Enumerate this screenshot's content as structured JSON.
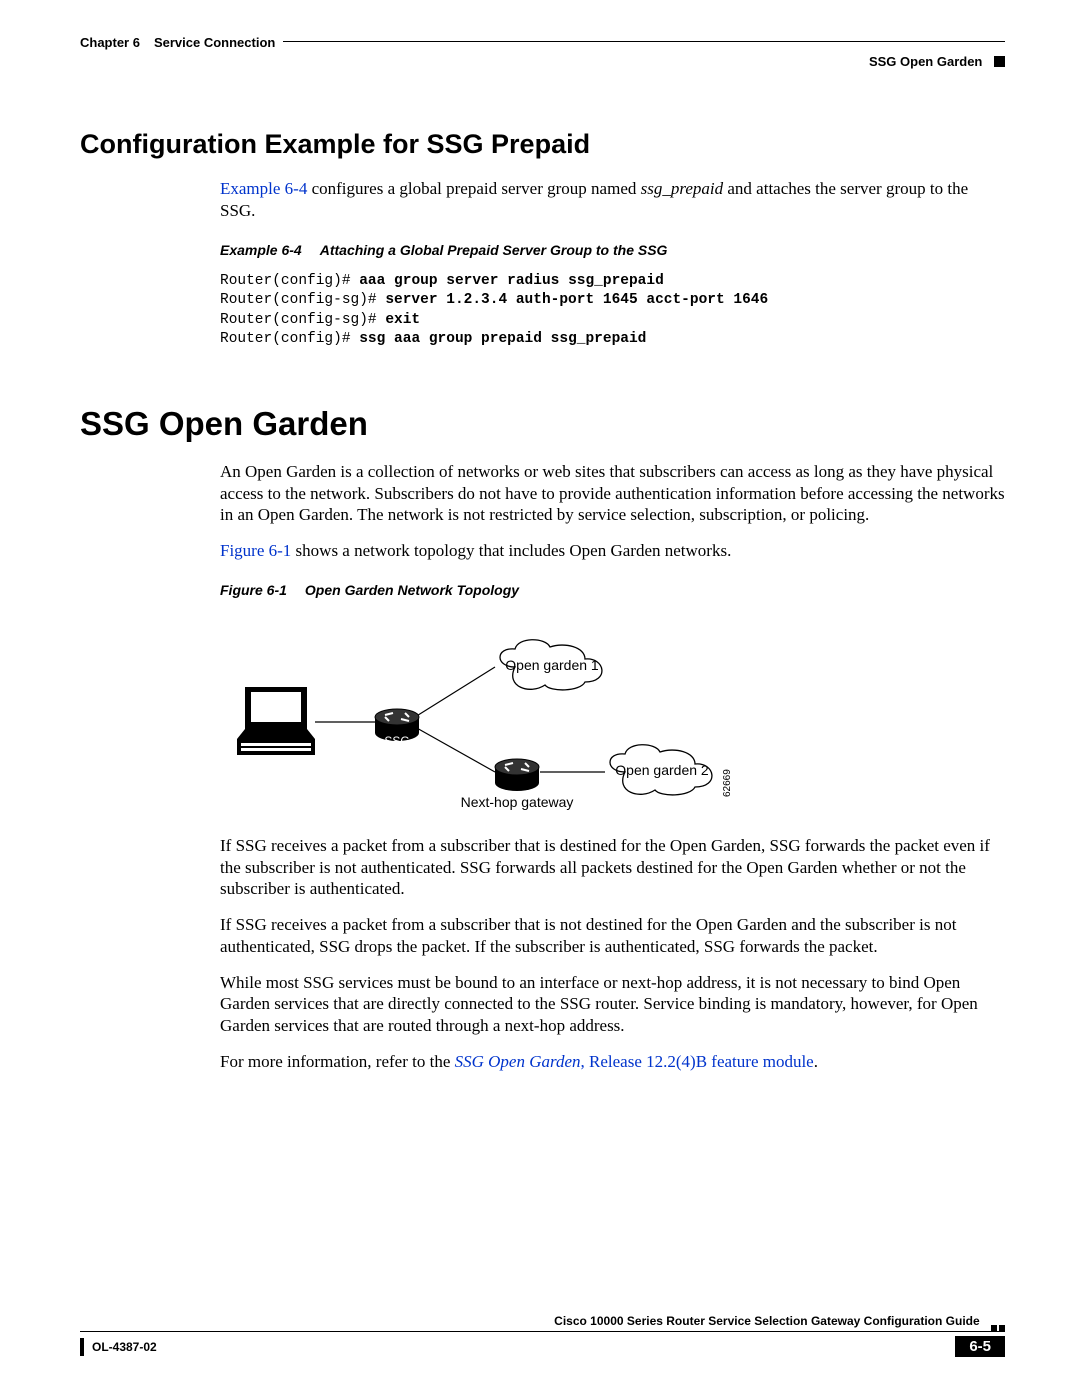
{
  "header": {
    "chapter": "Chapter 6",
    "chapter_title": "Service Connection",
    "section": "SSG Open Garden"
  },
  "sec1": {
    "title": "Configuration Example for SSG Prepaid",
    "para_link": "Example 6-4",
    "para_mid1": " configures a global prepaid server group named ",
    "para_em": "ssg_prepaid",
    "para_end": " and attaches the server group to the SSG.",
    "caption_label": "Example 6-4",
    "caption_text": "Attaching a Global Prepaid Server Group to the SSG",
    "code": {
      "l1a": "Router(config)# ",
      "l1b": "aaa group server radius ssg_prepaid",
      "l2a": "Router(config-sg)# ",
      "l2b": "server 1.2.3.4 auth-port 1645 acct-port 1646",
      "l3a": "Router(config-sg)# ",
      "l3b": "exit",
      "l4a": "Router(config)# ",
      "l4b": "ssg aaa group prepaid ssg_prepaid"
    }
  },
  "sec2": {
    "title": "SSG Open Garden",
    "para1": "An Open Garden is a collection of networks or web sites that subscribers can access as long as they have physical access to the network. Subscribers do not have to provide authentication information before accessing the networks in an Open Garden. The network is not restricted by service selection, subscription, or policing.",
    "para2_link": "Figure 6-1",
    "para2_rest": " shows a network topology that includes Open Garden networks.",
    "fig_caption_label": "Figure 6-1",
    "fig_caption_text": "Open Garden Network Topology",
    "fig_labels": {
      "og1": "Open garden 1",
      "og2": "Open garden 2",
      "ssg": "SSG",
      "nexthop": "Next-hop gateway",
      "id": "62669"
    },
    "para3": "If SSG receives a packet from a subscriber that is destined for the Open Garden, SSG forwards the packet even if the subscriber is not authenticated. SSG forwards all packets destined for the Open Garden whether or not the subscriber is authenticated.",
    "para4": "If SSG receives a packet from a subscriber that is not destined for the Open Garden and the subscriber is not authenticated, SSG drops the packet. If the subscriber is authenticated, SSG forwards the packet.",
    "para5": "While most SSG services must be bound to an interface or next-hop address, it is not necessary to bind Open Garden services that are directly connected to the SSG router. Service binding is mandatory, however, for Open Garden services that are routed through a next-hop address.",
    "para6_pre": "For more information, refer to the ",
    "para6_link_em": "SSG Open Garden",
    "para6_link_rest": ", Release 12.2(4)B feature module",
    "para6_end": "."
  },
  "footer": {
    "doc_title": "Cisco 10000 Series Router Service Selection Gateway Configuration Guide",
    "doc_id": "OL-4387-02",
    "pagenum": "6-5"
  }
}
